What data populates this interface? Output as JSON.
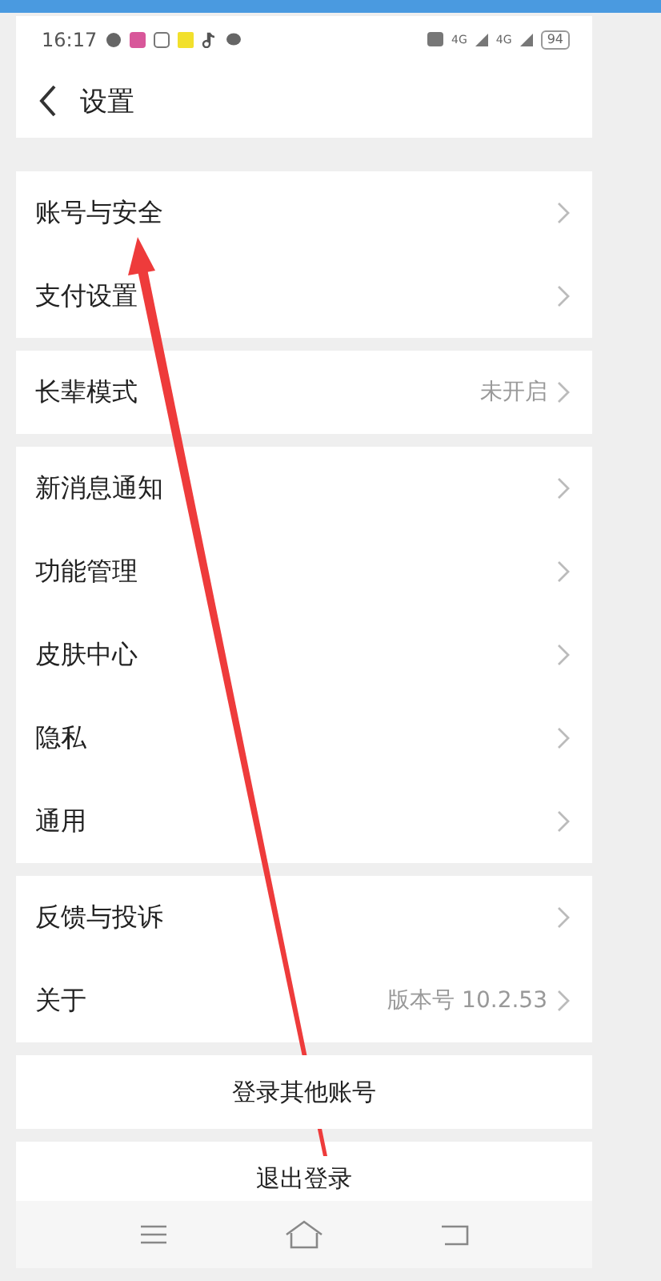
{
  "status_bar": {
    "time": "16:17",
    "network": [
      "4G",
      "4G"
    ],
    "battery": "94"
  },
  "header": {
    "title": "设置"
  },
  "groups": [
    {
      "items": [
        {
          "label": "账号与安全"
        },
        {
          "label": "支付设置"
        }
      ]
    },
    {
      "items": [
        {
          "label": "长辈模式",
          "value": "未开启"
        }
      ]
    },
    {
      "items": [
        {
          "label": "新消息通知"
        },
        {
          "label": "功能管理"
        },
        {
          "label": "皮肤中心"
        },
        {
          "label": "隐私"
        },
        {
          "label": "通用"
        }
      ]
    },
    {
      "items": [
        {
          "label": "反馈与投诉"
        },
        {
          "label": "关于",
          "value": "版本号 10.2.53"
        }
      ]
    }
  ],
  "buttons": [
    "登录其他账号",
    "退出登录"
  ],
  "annotation": {
    "kind": "arrow"
  }
}
